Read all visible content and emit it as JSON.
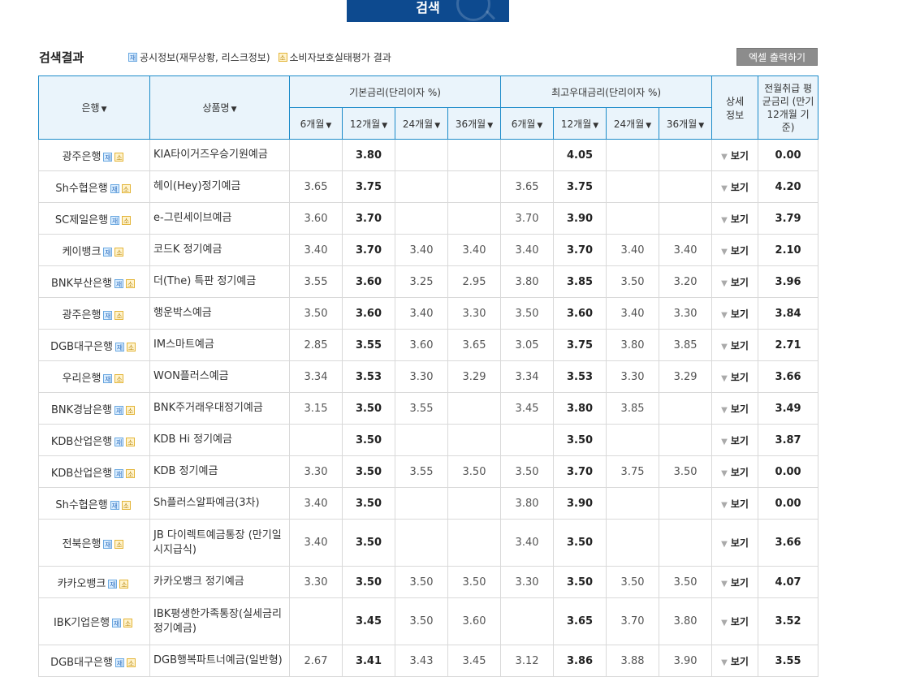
{
  "search_button": {
    "label": "검색"
  },
  "results": {
    "title": "검색결과",
    "legend_jae_label": "공시정보(재무상황, 리스크정보)",
    "legend_so_label": "소비자보호실태평가 결과",
    "excel_label": "엑셀 출력하기"
  },
  "badges": {
    "jae": "재",
    "so": "소"
  },
  "table": {
    "headers": {
      "bank": "은행",
      "product": "상품명",
      "basic_rate": "기본금리(단리이자 %)",
      "max_rate": "최고우대금리(단리이자 %)",
      "detail": "상세 정보",
      "avg_rate": "전월취급 평균금리 (만기 12개월 기준)"
    },
    "periods": [
      "6개월",
      "12개월",
      "24개월",
      "36개월"
    ],
    "view_label": "보기",
    "rows": [
      {
        "bank": "광주은행",
        "product": "KIA타이거즈우승기원예금",
        "basic": [
          "",
          "3.80",
          "",
          ""
        ],
        "max": [
          "",
          "4.05",
          "",
          ""
        ],
        "avg": "0.00"
      },
      {
        "bank": "Sh수협은행",
        "product": "헤이(Hey)정기예금",
        "basic": [
          "3.65",
          "3.75",
          "",
          ""
        ],
        "max": [
          "3.65",
          "3.75",
          "",
          ""
        ],
        "avg": "4.20"
      },
      {
        "bank": "SC제일은행",
        "product": "e-그린세이브예금",
        "basic": [
          "3.60",
          "3.70",
          "",
          ""
        ],
        "max": [
          "3.70",
          "3.90",
          "",
          ""
        ],
        "avg": "3.79"
      },
      {
        "bank": "케이뱅크",
        "product": "코드K 정기예금",
        "basic": [
          "3.40",
          "3.70",
          "3.40",
          "3.40"
        ],
        "max": [
          "3.40",
          "3.70",
          "3.40",
          "3.40"
        ],
        "avg": "2.10"
      },
      {
        "bank": "BNK부산은행",
        "product": "더(The) 특판 정기예금",
        "basic": [
          "3.55",
          "3.60",
          "3.25",
          "2.95"
        ],
        "max": [
          "3.80",
          "3.85",
          "3.50",
          "3.20"
        ],
        "avg": "3.96"
      },
      {
        "bank": "광주은행",
        "product": "행운박스예금",
        "basic": [
          "3.50",
          "3.60",
          "3.40",
          "3.30"
        ],
        "max": [
          "3.50",
          "3.60",
          "3.40",
          "3.30"
        ],
        "avg": "3.84"
      },
      {
        "bank": "DGB대구은행",
        "product": "IM스마트예금",
        "basic": [
          "2.85",
          "3.55",
          "3.60",
          "3.65"
        ],
        "max": [
          "3.05",
          "3.75",
          "3.80",
          "3.85"
        ],
        "avg": "2.71"
      },
      {
        "bank": "우리은행",
        "product": "WON플러스예금",
        "basic": [
          "3.34",
          "3.53",
          "3.30",
          "3.29"
        ],
        "max": [
          "3.34",
          "3.53",
          "3.30",
          "3.29"
        ],
        "avg": "3.66"
      },
      {
        "bank": "BNK경남은행",
        "product": "BNK주거래우대정기예금",
        "basic": [
          "3.15",
          "3.50",
          "3.55",
          ""
        ],
        "max": [
          "3.45",
          "3.80",
          "3.85",
          ""
        ],
        "avg": "3.49"
      },
      {
        "bank": "KDB산업은행",
        "product": "KDB Hi 정기예금",
        "basic": [
          "",
          "3.50",
          "",
          ""
        ],
        "max": [
          "",
          "3.50",
          "",
          ""
        ],
        "avg": "3.87"
      },
      {
        "bank": "KDB산업은행",
        "product": "KDB 정기예금",
        "basic": [
          "3.30",
          "3.50",
          "3.55",
          "3.50"
        ],
        "max": [
          "3.50",
          "3.70",
          "3.75",
          "3.50"
        ],
        "avg": "0.00"
      },
      {
        "bank": "Sh수협은행",
        "product": "Sh플러스알파예금(3차)",
        "basic": [
          "3.40",
          "3.50",
          "",
          ""
        ],
        "max": [
          "3.80",
          "3.90",
          "",
          ""
        ],
        "avg": "0.00"
      },
      {
        "bank": "전북은행",
        "product": "JB 다이렉트예금통장 (만기일시지급식)",
        "basic": [
          "3.40",
          "3.50",
          "",
          ""
        ],
        "max": [
          "3.40",
          "3.50",
          "",
          ""
        ],
        "avg": "3.66",
        "tall": true
      },
      {
        "bank": "카카오뱅크",
        "product": "카카오뱅크 정기예금",
        "basic": [
          "3.30",
          "3.50",
          "3.50",
          "3.50"
        ],
        "max": [
          "3.30",
          "3.50",
          "3.50",
          "3.50"
        ],
        "avg": "4.07"
      },
      {
        "bank": "IBK기업은행",
        "product": "IBK평생한가족통장(실세금리정기예금)",
        "basic": [
          "",
          "3.45",
          "3.50",
          "3.60"
        ],
        "max": [
          "",
          "3.65",
          "3.70",
          "3.80"
        ],
        "avg": "3.52",
        "tall": true
      },
      {
        "bank": "DGB대구은행",
        "product": "DGB행복파트너예금(일반형)",
        "basic": [
          "2.67",
          "3.41",
          "3.43",
          "3.45"
        ],
        "max": [
          "3.12",
          "3.86",
          "3.88",
          "3.90"
        ],
        "avg": "3.55"
      }
    ]
  }
}
